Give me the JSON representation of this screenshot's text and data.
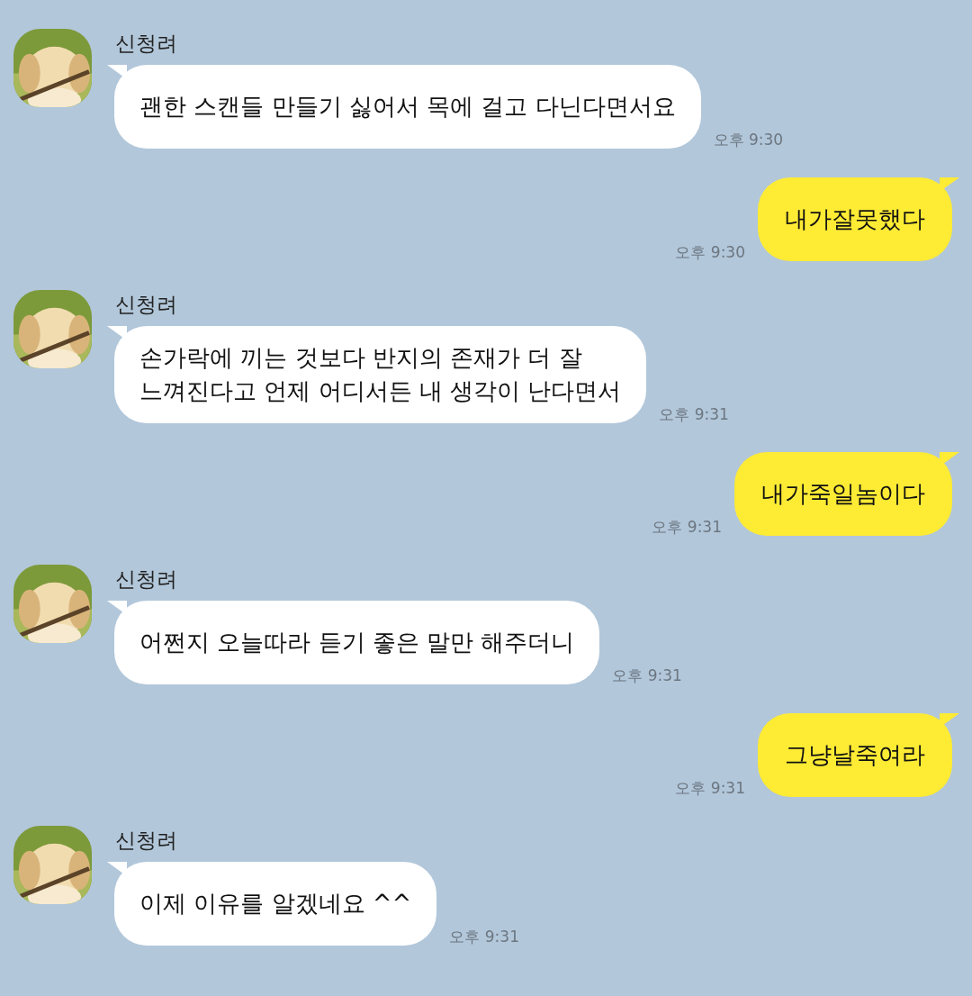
{
  "messages": [
    {
      "kind": "incoming",
      "sender": "신청려",
      "text": "괜한 스캔들 만들기 싫어서 목에 걸고 다닌다면서요",
      "time": "오후 9:30"
    },
    {
      "kind": "outgoing",
      "text": "내가잘못했다",
      "time": "오후 9:30"
    },
    {
      "kind": "incoming",
      "sender": "신청려",
      "text": "손가락에 끼는 것보다 반지의 존재가 더 잘\n느껴진다고 언제 어디서든 내 생각이 난다면서",
      "time": "오후 9:31"
    },
    {
      "kind": "outgoing",
      "text": "내가죽일놈이다",
      "time": "오후 9:31"
    },
    {
      "kind": "incoming",
      "sender": "신청려",
      "text": "어쩐지 오늘따라 듣기 좋은 말만 해주더니",
      "time": "오후 9:31"
    },
    {
      "kind": "outgoing",
      "text": "그냥날죽여라",
      "time": "오후 9:31"
    },
    {
      "kind": "incoming",
      "sender": "신청려",
      "text": "이제 이유를 알겠네요 ^^",
      "time": "오후 9:31"
    }
  ]
}
